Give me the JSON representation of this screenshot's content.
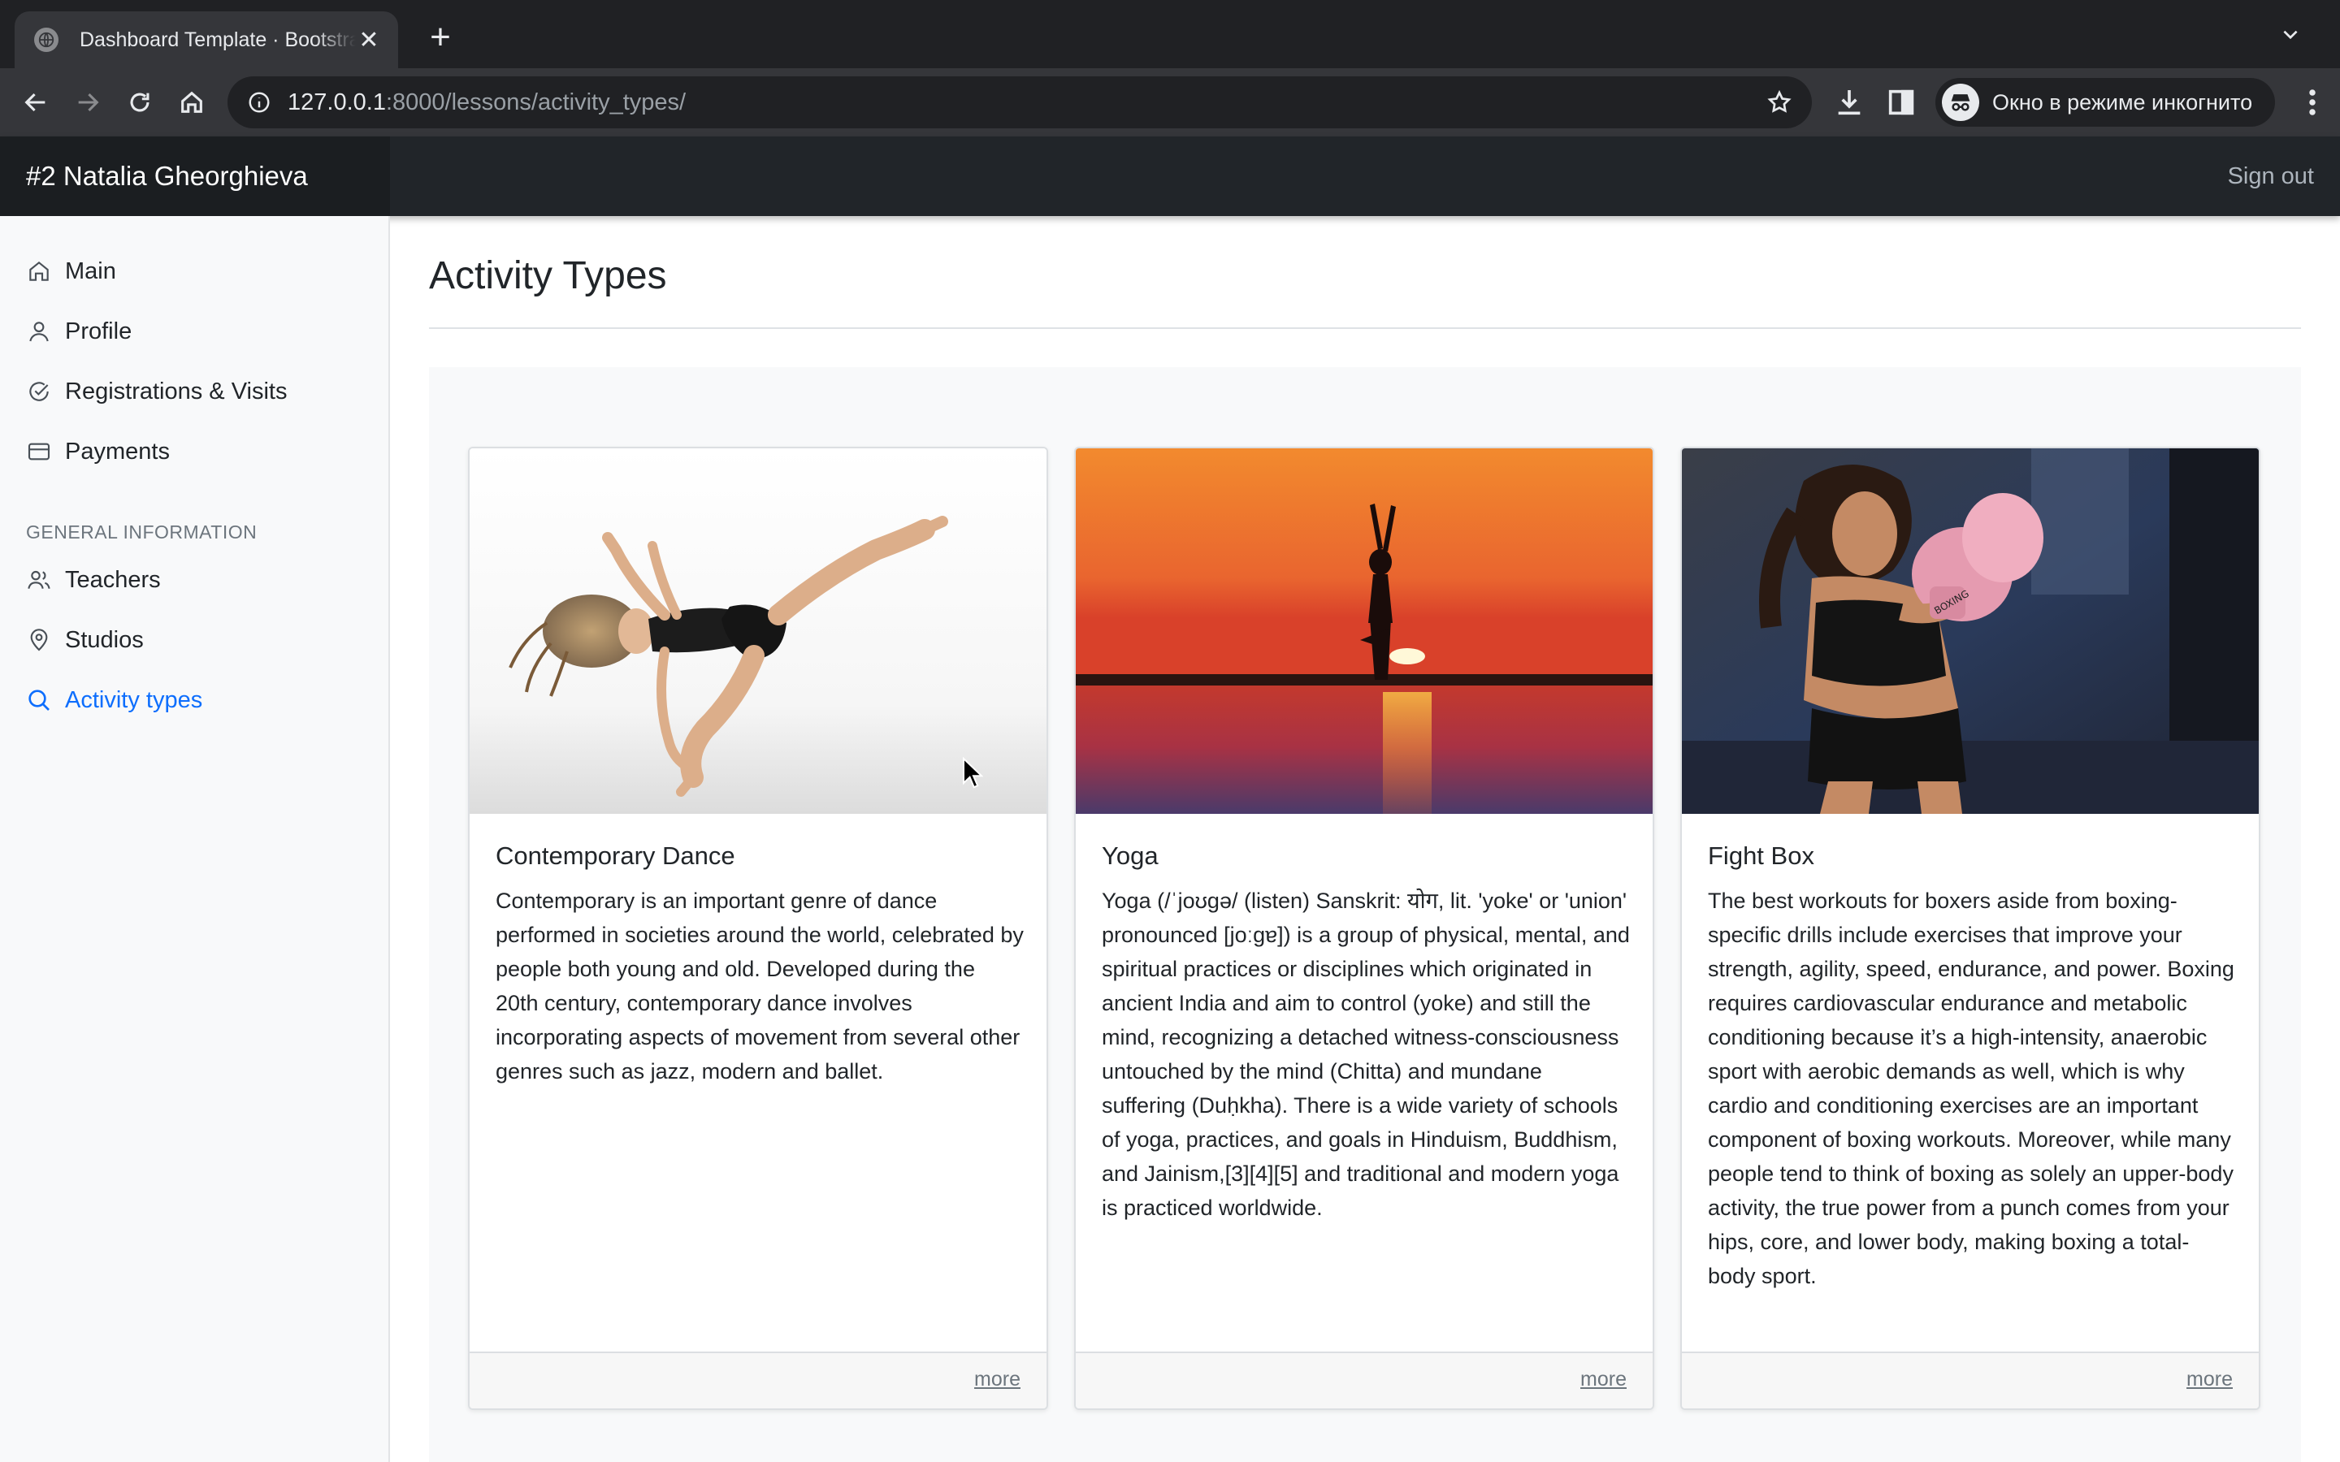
{
  "browser": {
    "tab_title": "Dashboard Template · Bootstrap",
    "url_host": "127.0.0.1",
    "url_path": ":8000/lessons/activity_types/",
    "incognito_label": "Окно в режиме инкогнито"
  },
  "navbar": {
    "brand": "#2 Natalia Gheorghieva",
    "sign_out": "Sign out"
  },
  "sidebar": {
    "items": [
      {
        "label": "Main",
        "icon": "home-icon"
      },
      {
        "label": "Profile",
        "icon": "user-icon"
      },
      {
        "label": "Registrations & Visits",
        "icon": "check-circle-icon"
      },
      {
        "label": "Payments",
        "icon": "credit-card-icon"
      }
    ],
    "section_heading": "GENERAL INFORMATION",
    "section_items": [
      {
        "label": "Teachers",
        "icon": "users-icon"
      },
      {
        "label": "Studios",
        "icon": "map-pin-icon"
      },
      {
        "label": "Activity types",
        "icon": "search-icon",
        "active": true
      }
    ]
  },
  "main": {
    "title": "Activity Types",
    "cards": [
      {
        "title": "Contemporary Dance",
        "text": "Contemporary is an important genre of dance performed in societies around the world, celebrated by people both young and old. Developed during the 20th century, contemporary dance involves incorporating aspects of movement from several other genres such as jazz, modern and ballet.",
        "link": "more"
      },
      {
        "title": "Yoga",
        "text": "Yoga (/ˈjoʊɡə/ (listen) Sanskrit: योग, lit. 'yoke' or 'union' pronounced [joːɡɐ]) is a group of physical, mental, and spiritual practices or disciplines which originated in ancient India and aim to control (yoke) and still the mind, recognizing a detached witness-consciousness untouched by the mind (Chitta) and mundane suffering (Duḥkha). There is a wide variety of schools of yoga, practices, and goals in Hinduism, Buddhism, and Jainism,[3][4][5] and traditional and modern yoga is practiced worldwide.",
        "link": "more"
      },
      {
        "title": "Fight Box",
        "text": "The best workouts for boxers aside from boxing-specific drills include exercises that improve your strength, agility, speed, endurance, and power. Boxing requires cardiovascular endurance and metabolic conditioning because it’s a high-intensity, anaerobic sport with aerobic demands as well, which is why cardio and conditioning exercises are an important component of boxing workouts. Moreover, while many people tend to think of boxing as solely an upper-body activity, the true power from a punch comes from your hips, core, and lower body, making boxing a total-body sport.",
        "link": "more"
      }
    ]
  },
  "colors": {
    "accent": "#0d6efd",
    "navbar_bg": "#212529",
    "sidebar_bg": "#f8f9fa",
    "chrome_bg": "#35363a"
  }
}
